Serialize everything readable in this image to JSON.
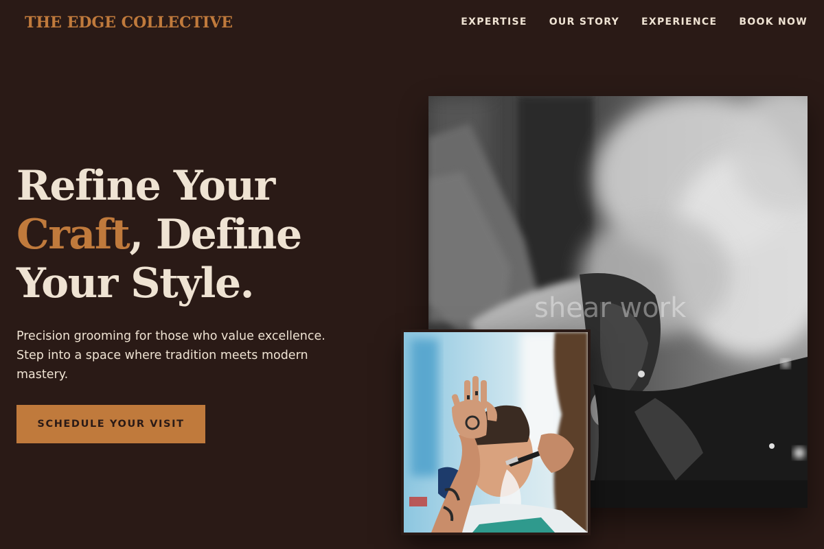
{
  "brand": {
    "name": "THE EDGE COLLECTIVE"
  },
  "nav": {
    "items": [
      "EXPERTISE",
      "OUR STORY",
      "EXPERIENCE",
      "BOOK NOW"
    ]
  },
  "hero": {
    "title_line1": "Refine Your",
    "title_accent": "Craft",
    "title_line2_rest": ", Define",
    "title_line3": "Your Style.",
    "subtitle": "Precision grooming for those who value excellence. Step into a space where tradition meets modern mastery.",
    "cta_label": "SCHEDULE YOUR VISIT"
  },
  "images": {
    "main_watermark": "shear work"
  },
  "colors": {
    "background": "#2a1a16",
    "accent": "#c07a3c",
    "text": "#efe3d3"
  }
}
